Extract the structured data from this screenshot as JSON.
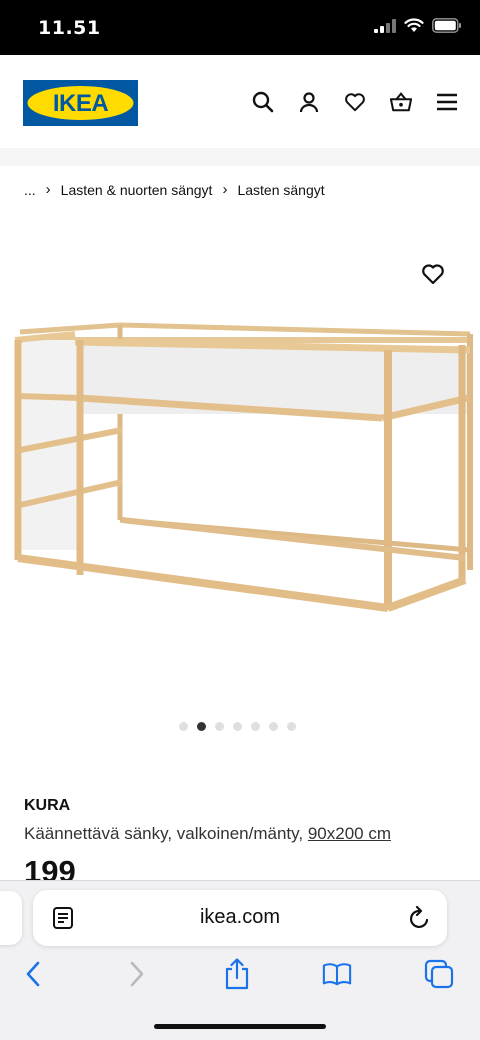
{
  "status_bar": {
    "time": "11.51"
  },
  "header": {
    "logo_text": "IKEA",
    "brand_colors": {
      "blue": "#0058a3",
      "yellow": "#ffdb00"
    },
    "icons": [
      "search-icon",
      "user-icon",
      "heart-icon",
      "basket-icon",
      "menu-icon"
    ]
  },
  "breadcrumb": [
    "...",
    "Lasten & nuorten sängyt",
    "Lasten sängyt"
  ],
  "product": {
    "name": "KURA",
    "description": "Käännettävä sänky, valkoinen/mänty,",
    "dimensions": "90x200 cm",
    "price": "199",
    "image_dots": 7,
    "active_dot": 2
  },
  "browser": {
    "url": "ikea.com",
    "toolbar_icons": [
      "back-icon",
      "forward-icon",
      "share-icon",
      "bookmarks-icon",
      "tabs-icon"
    ]
  }
}
